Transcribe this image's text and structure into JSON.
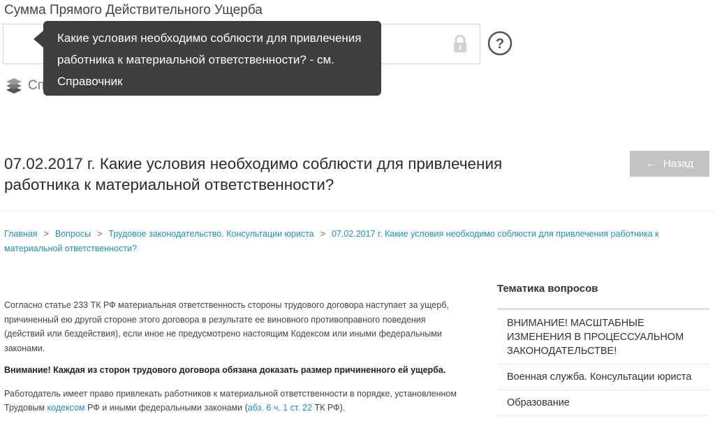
{
  "field": {
    "label": "Сумма Прямого Действительного Ущерба"
  },
  "tooltip": {
    "text": "Какие условия необходимо соблюсти для привлечения работника к материальной ответственности? - см. Справочник"
  },
  "reference": {
    "label": "Справочник"
  },
  "page": {
    "title": "07.02.2017 г. Какие условия необходимо соблюсти для привлечения работника к материальной ответственности?",
    "back_label": "Назад"
  },
  "breadcrumb": {
    "items": [
      "Главная",
      "Вопросы",
      "Трудовое законодательство. Консультации юриста",
      "07.02.2017 г. Какие условия необходимо соблюсти для привлечения работника к материальной ответственности?"
    ],
    "separator": ">"
  },
  "content": {
    "p1": "Согласно статье 233 ТК РФ материальная ответственность стороны трудового договора наступает за ущерб, причиненный ею другой стороне этого договора в результате ее виновного противоправного поведения (действий или бездействия), если иное не предусмотрено настоящим Кодексом или иными федеральными законами.",
    "warning": "Внимание! Каждая из сторон трудового договора обязана доказать размер причиненного ей ущерба.",
    "p3_before": "Работодатель имеет право привлекать работников к материальной ответственности в порядке, установленном Трудовым ",
    "p3_link1": "кодексом",
    "p3_middle": " РФ и иными федеральными законами (",
    "p3_link2": "абз. 6 ч. 1 ст. 22",
    "p3_after": " ТК РФ)."
  },
  "sidebar": {
    "title": "Тематика вопросов",
    "items": [
      "ВНИМАНИЕ! МАСШТАБНЫЕ ИЗМЕНЕНИЯ В ПРОЦЕССУАЛЬНОМ ЗАКОНОДАТЕЛЬСТВЕ!",
      "Военная служба. Консультации юриста",
      "Образование"
    ]
  },
  "icons": {
    "lock": "lock-icon",
    "help": "question-circle-icon",
    "book": "book-stack-icon",
    "back": "arrow-left-icon"
  },
  "colors": {
    "link": "#1a8fc1",
    "tooltip_bg": "#3f3f3f",
    "back_button_bg": "#c3c3c3"
  }
}
